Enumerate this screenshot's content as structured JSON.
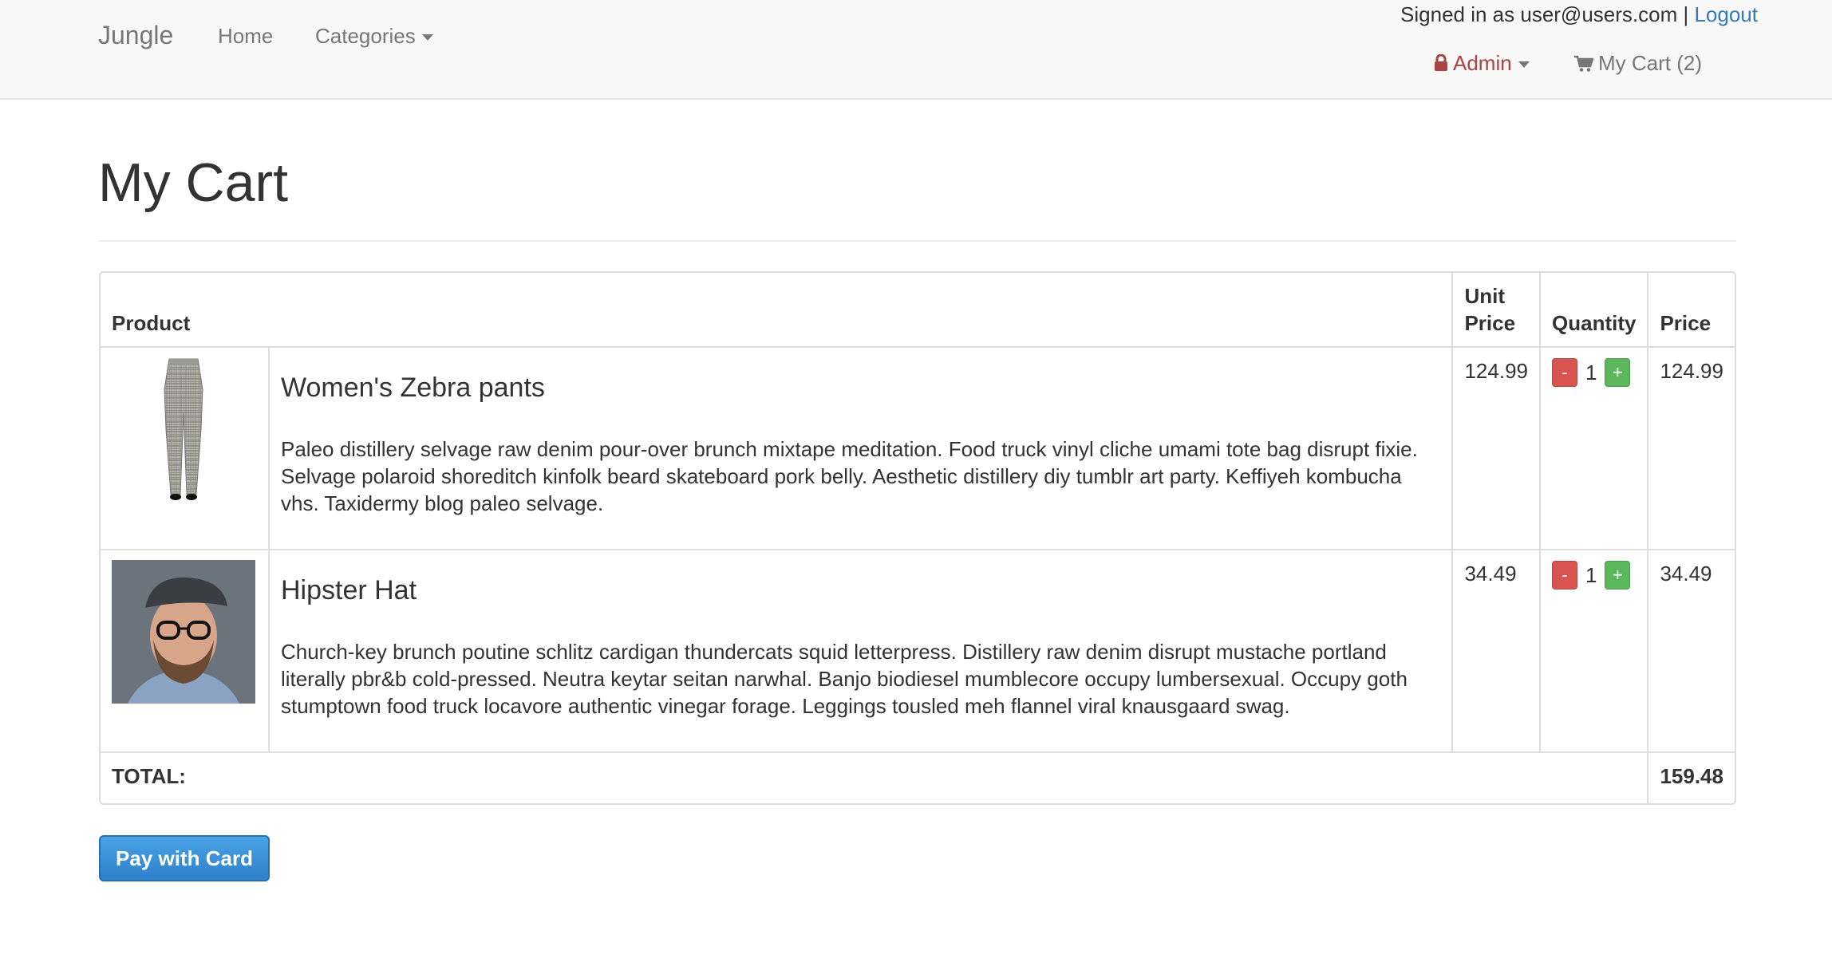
{
  "navbar": {
    "brand": "Jungle",
    "home": "Home",
    "categories": "Categories",
    "signed_in_text": "Signed in as user@users.com |",
    "logout": "Logout",
    "admin": "Admin",
    "cart": "My Cart (2)"
  },
  "page": {
    "title": "My Cart"
  },
  "table": {
    "headers": {
      "product": "Product",
      "unit_price": "Unit Price",
      "quantity": "Quantity",
      "price": "Price"
    },
    "items": [
      {
        "name": "Women's Zebra pants",
        "description": "Paleo distillery selvage raw denim pour-over brunch mixtape meditation. Food truck vinyl cliche umami tote bag disrupt fixie. Selvage polaroid shoreditch kinfolk beard skateboard pork belly. Aesthetic distillery diy tumblr art party. Keffiyeh kombucha vhs. Taxidermy blog paleo selvage.",
        "unit_price": "124.99",
        "quantity": "1",
        "price": "124.99",
        "minus": "-",
        "plus": "+"
      },
      {
        "name": "Hipster Hat",
        "description": "Church-key brunch poutine schlitz cardigan thundercats squid letterpress. Distillery raw denim disrupt mustache portland literally pbr&b cold-pressed. Neutra keytar seitan narwhal. Banjo biodiesel mumblecore occupy lumbersexual. Occupy goth stumptown food truck locavore authentic vinegar forage. Leggings tousled meh flannel viral knausgaard swag.",
        "unit_price": "34.49",
        "quantity": "1",
        "price": "34.49",
        "minus": "-",
        "plus": "+"
      }
    ],
    "total_label": "TOTAL:",
    "total_value": "159.48"
  },
  "pay_button": "Pay with Card",
  "colors": {
    "link": "#337ab7",
    "admin": "#a94442",
    "minus_button": "#d9534f",
    "plus_button": "#5cb85c",
    "pay_button": "#2e7fcb"
  },
  "icons": [
    "lock-icon",
    "cart-icon",
    "caret-down-icon"
  ]
}
